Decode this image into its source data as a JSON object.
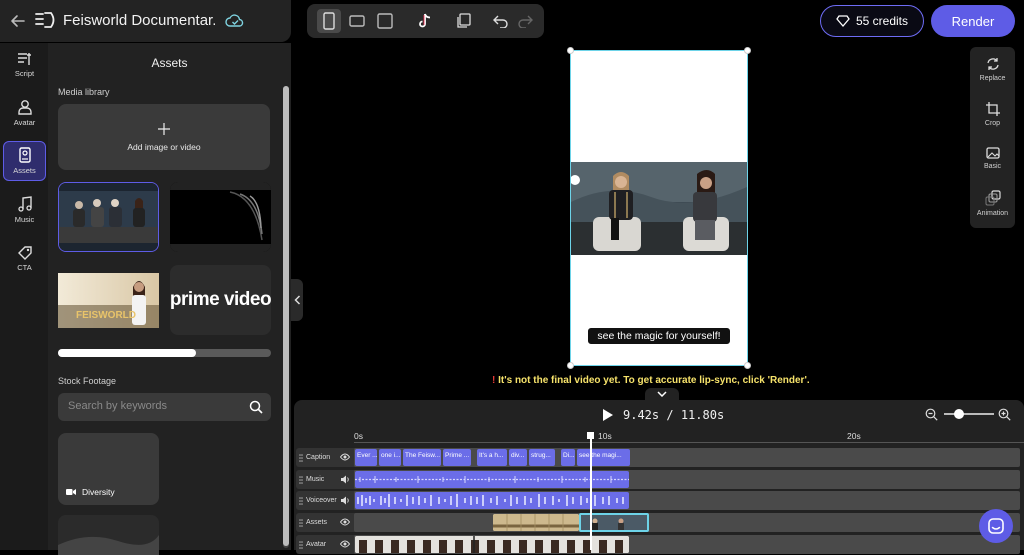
{
  "header": {
    "project_title": "Feisworld Documentar...",
    "credits_label": "55 credits",
    "render_label": "Render"
  },
  "rail": {
    "items": [
      {
        "label": "Script",
        "icon": "script-icon"
      },
      {
        "label": "Avatar",
        "icon": "avatar-icon"
      },
      {
        "label": "Assets",
        "icon": "assets-icon",
        "active": true
      },
      {
        "label": "Music",
        "icon": "music-icon"
      },
      {
        "label": "CTA",
        "icon": "cta-icon"
      }
    ]
  },
  "panel": {
    "title": "Assets",
    "media_library_label": "Media library",
    "add_media_label": "Add image or video",
    "thumb3_text": "FEISWORLD",
    "thumb4_text": "prime video",
    "upload_progress": 0.65,
    "stock_label": "Stock Footage",
    "search_placeholder": "Search by keywords",
    "stock_items": [
      {
        "label": "Diversity",
        "icon": "video-camera-icon"
      }
    ]
  },
  "preview": {
    "caption": "see the magic for yourself!",
    "warning_mark": "!",
    "warning_text": "It's not the final video yet. To get accurate lip-sync, click 'Render'."
  },
  "right_tools": [
    {
      "label": "Replace",
      "icon": "replace-icon"
    },
    {
      "label": "Crop",
      "icon": "crop-icon"
    },
    {
      "label": "Basic",
      "icon": "image-icon"
    },
    {
      "label": "Animation",
      "icon": "animation-icon"
    }
  ],
  "timeline": {
    "current_time": "9.42s",
    "total_time": "11.80s",
    "time_separator": "/",
    "ruler_labels": [
      "0s",
      "10s",
      "20s"
    ],
    "tracks": [
      {
        "label": "Caption",
        "icon": "eye-icon"
      },
      {
        "label": "Music",
        "icon": "speaker-icon"
      },
      {
        "label": "Voiceover",
        "icon": "speaker-icon"
      },
      {
        "label": "Assets",
        "icon": "eye-icon"
      },
      {
        "label": "Avatar",
        "icon": "eye-icon"
      }
    ],
    "caption_segments": [
      "Ever ...",
      "one i...",
      "The Feisw...",
      "Prime ...",
      "It's a h...",
      "div...",
      "strug...",
      "Di...",
      "see the magi..."
    ]
  },
  "colors": {
    "accent": "#5e5ce6",
    "caption_track": "#6b6de8",
    "warning": "#f7e36b",
    "canvas_border": "#6dd3e8"
  }
}
